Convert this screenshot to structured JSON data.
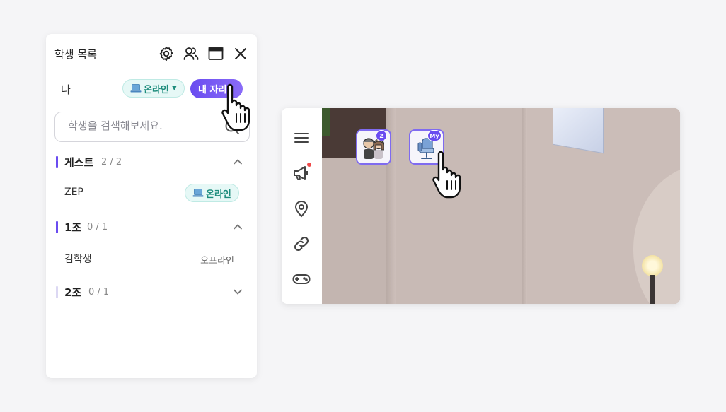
{
  "panel": {
    "title": "학생 목록",
    "me": {
      "label": "나",
      "status": "온라인",
      "my_location_button": "내 자리"
    },
    "search": {
      "placeholder": "학생을 검색해보세요."
    },
    "groups": [
      {
        "name": "게스트",
        "count": "2 / 2",
        "expanded": true,
        "members": [
          {
            "name": "ZEP",
            "status": "온라인"
          }
        ]
      },
      {
        "name": "1조",
        "count": "0 / 1",
        "expanded": true,
        "members": [
          {
            "name": "김학생",
            "status": "오프라인"
          }
        ]
      },
      {
        "name": "2조",
        "count": "0 / 1",
        "expanded": false,
        "members": []
      }
    ]
  },
  "map_window": {
    "toolbar_icons": [
      "menu-icon",
      "megaphone-icon",
      "location-pin-icon",
      "link-icon",
      "gamepad-icon"
    ],
    "avatars": [
      {
        "name": "group-avatar",
        "badge": "2"
      },
      {
        "name": "my-avatar",
        "badge": "My"
      }
    ]
  },
  "colors": {
    "accent": "#6a4cf0",
    "online_bg": "#e6f8f6",
    "online_text": "#1d8c7c",
    "notification": "#ef4a4a"
  }
}
